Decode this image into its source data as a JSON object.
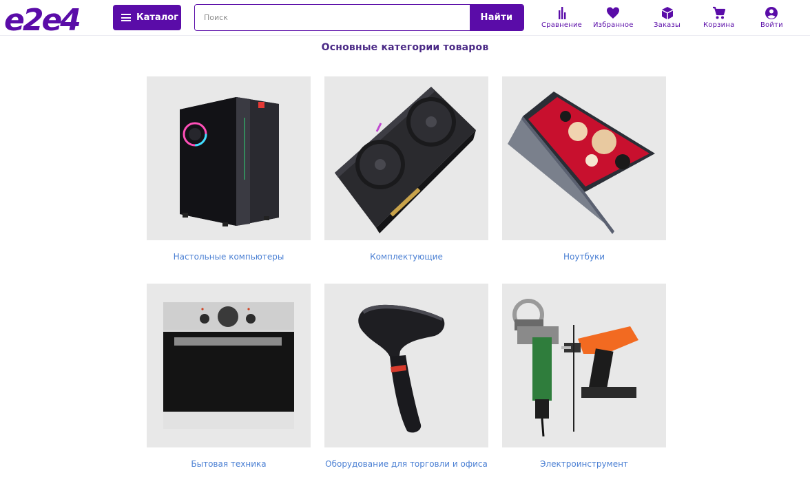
{
  "header": {
    "logo_text": "e2e4",
    "catalog_label": "Каталог",
    "search_placeholder": "Поиск",
    "search_button": "Найти",
    "nav": [
      {
        "label": "Сравнение",
        "icon": "compare-icon"
      },
      {
        "label": "Избранное",
        "icon": "heart-icon"
      },
      {
        "label": "Заказы",
        "icon": "box-icon"
      },
      {
        "label": "Корзина",
        "icon": "cart-icon"
      },
      {
        "label": "Войти",
        "icon": "user-icon"
      }
    ]
  },
  "main": {
    "title": "Основные категории товаров",
    "categories": [
      {
        "label": "Настольные компьютеры",
        "image": "desktop-pc-image"
      },
      {
        "label": "Комплектующие",
        "image": "graphics-card-image"
      },
      {
        "label": "Ноутбуки",
        "image": "laptop-image"
      },
      {
        "label": "Бытовая техника",
        "image": "oven-image"
      },
      {
        "label": "Оборудование для торговли и офиса",
        "image": "barcode-scanner-image"
      },
      {
        "label": "Электроинструмент",
        "image": "power-tools-image"
      }
    ]
  },
  "colors": {
    "brand": "#5a0ca8",
    "title": "#4b2a86",
    "link": "#4a7fd3",
    "tile_bg": "#e8e8e8"
  }
}
